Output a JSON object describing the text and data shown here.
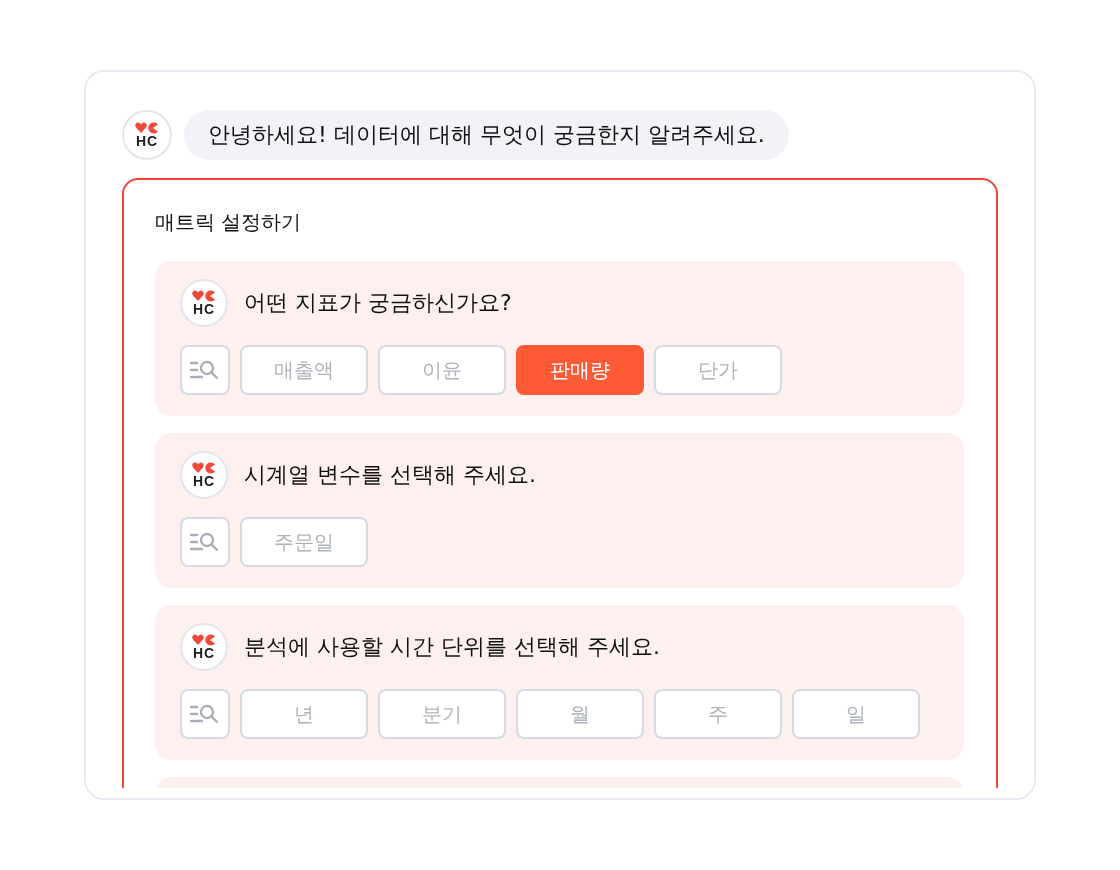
{
  "greeting": {
    "logo_text": "HC",
    "message": "안녕하세요! 데이터에 대해 무엇이 궁금한지 알려주세요."
  },
  "panel": {
    "title": "매트릭 설정하기",
    "steps": [
      {
        "logo_text": "HC",
        "question": "어떤 지표가 궁금하신가요?",
        "options": [
          {
            "label": "매출액",
            "selected": false
          },
          {
            "label": "이윤",
            "selected": false
          },
          {
            "label": "판매량",
            "selected": true
          },
          {
            "label": "단가",
            "selected": false
          }
        ]
      },
      {
        "logo_text": "HC",
        "question": "시계열 변수를 선택해 주세요.",
        "options": [
          {
            "label": "주문일",
            "selected": false
          }
        ]
      },
      {
        "logo_text": "HC",
        "question": "분석에 사용할 시간 단위를 선택해 주세요.",
        "options": [
          {
            "label": "년",
            "selected": false
          },
          {
            "label": "분기",
            "selected": false
          },
          {
            "label": "월",
            "selected": false
          },
          {
            "label": "주",
            "selected": false
          },
          {
            "label": "일",
            "selected": false
          }
        ]
      }
    ]
  }
}
